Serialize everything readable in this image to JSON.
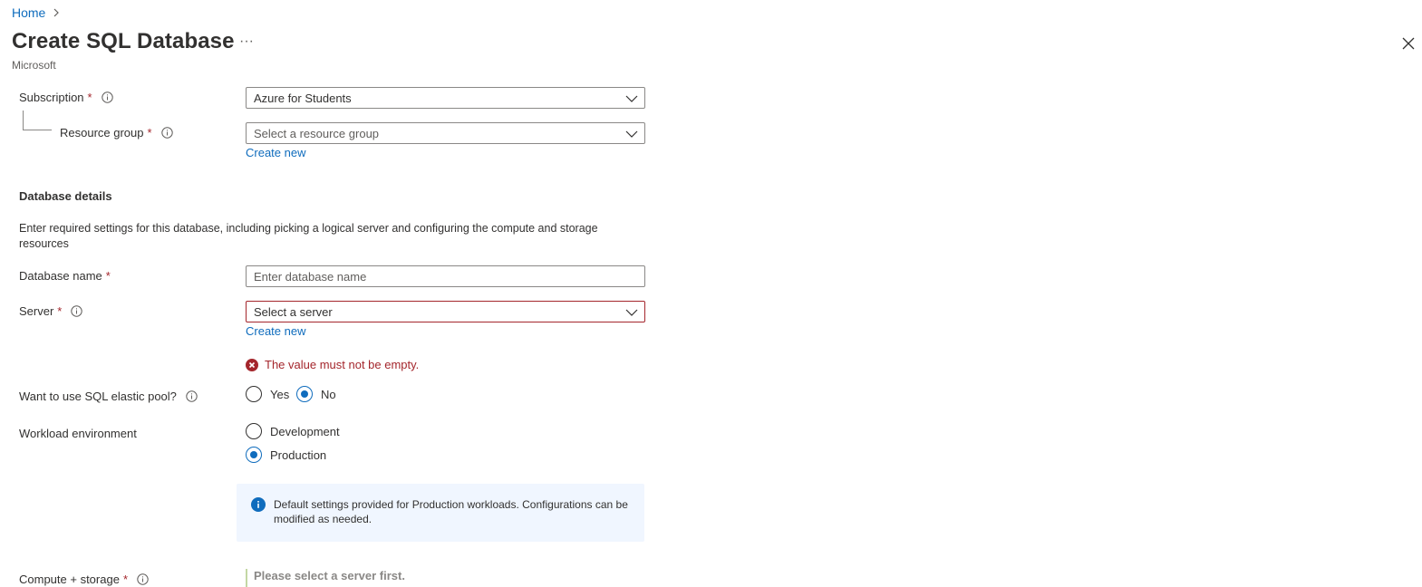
{
  "breadcrumb": {
    "home": "Home"
  },
  "header": {
    "title": "Create SQL Database",
    "more": "···",
    "publisher": "Microsoft"
  },
  "subscription": {
    "label": "Subscription",
    "required": "*",
    "value": "Azure for Students"
  },
  "resource_group": {
    "label": "Resource group",
    "required": "*",
    "placeholder": "Select a resource group",
    "create_new": "Create new"
  },
  "db_details": {
    "heading": "Database details",
    "description": "Enter required settings for this database, including picking a logical server and configuring the compute and storage resources"
  },
  "database_name": {
    "label": "Database name",
    "required": "*",
    "placeholder": "Enter database name"
  },
  "server": {
    "label": "Server",
    "required": "*",
    "placeholder": "Select a server",
    "create_new": "Create new",
    "error": "The value must not be empty."
  },
  "elastic_pool": {
    "label": "Want to use SQL elastic pool?",
    "options": [
      "Yes",
      "No"
    ],
    "selected": "No"
  },
  "workload": {
    "label": "Workload environment",
    "options": [
      "Development",
      "Production"
    ],
    "selected": "Production",
    "info": "Default settings provided for Production workloads. Configurations can be modified as needed."
  },
  "compute_storage": {
    "label": "Compute + storage",
    "required": "*",
    "note": "Please select a server first."
  },
  "colors": {
    "accent": "#0f6cbd",
    "error": "#a4262c",
    "info_bg": "#f0f6ff"
  },
  "icons": {
    "close": "close-icon",
    "info": "info-icon",
    "chevron": "chevron-down-icon",
    "error": "error-icon"
  }
}
